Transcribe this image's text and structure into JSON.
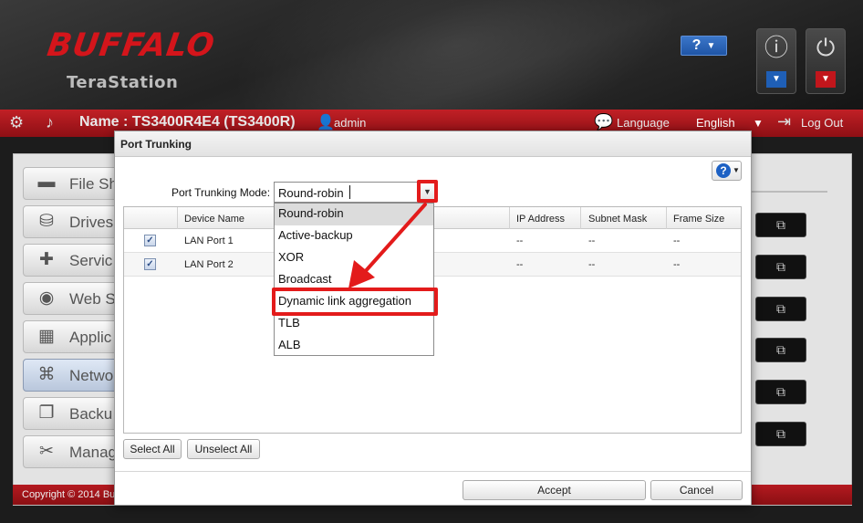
{
  "header": {
    "brand": "BUFFALO",
    "product": "TeraStation",
    "help_label": "?",
    "help_caret": "▼",
    "info_tag": "▼",
    "power_tag": "▼"
  },
  "navbar": {
    "device_name": "Name : TS3400R4E4 (TS3400R)",
    "user": "admin",
    "language_label": "Language",
    "language_value": "English",
    "logout": "Log Out"
  },
  "sidebar": {
    "items": [
      {
        "label": "File Sh",
        "icon": "folder-icon"
      },
      {
        "label": "Drives",
        "icon": "drive-icon"
      },
      {
        "label": "Servic",
        "icon": "services-icon"
      },
      {
        "label": "Web S",
        "icon": "web-service-icon"
      },
      {
        "label": "Applic",
        "icon": "applications-icon"
      },
      {
        "label": "Netwo",
        "icon": "network-icon"
      },
      {
        "label": "Backu",
        "icon": "backup-icon"
      },
      {
        "label": "Manag",
        "icon": "management-icon"
      }
    ]
  },
  "footer": {
    "copyright": "Copyright © 2014 Bu"
  },
  "modal": {
    "title": "Port Trunking",
    "help_label": "?",
    "mode_label": "Port Trunking Mode:",
    "mode_value": "Round-robin",
    "options": [
      "Round-robin",
      "Active-backup",
      "XOR",
      "Broadcast",
      "Dynamic link aggregation",
      "TLB",
      "ALB"
    ],
    "columns": {
      "device_name": "Device Name",
      "ip_address": "IP Address",
      "subnet_mask": "Subnet Mask",
      "frame_size": "Frame Size"
    },
    "rows": [
      {
        "device": "LAN Port 1",
        "ip": "--",
        "mask": "--",
        "frame": "--"
      },
      {
        "device": "LAN Port 2",
        "ip": "--",
        "mask": "--",
        "frame": "--"
      }
    ],
    "select_all": "Select All",
    "unselect_all": "Unselect All",
    "accept": "Accept",
    "cancel": "Cancel"
  },
  "colors": {
    "brand_red": "#d4151b",
    "annotation_red": "#e31b1b",
    "help_blue": "#1d61c4"
  }
}
